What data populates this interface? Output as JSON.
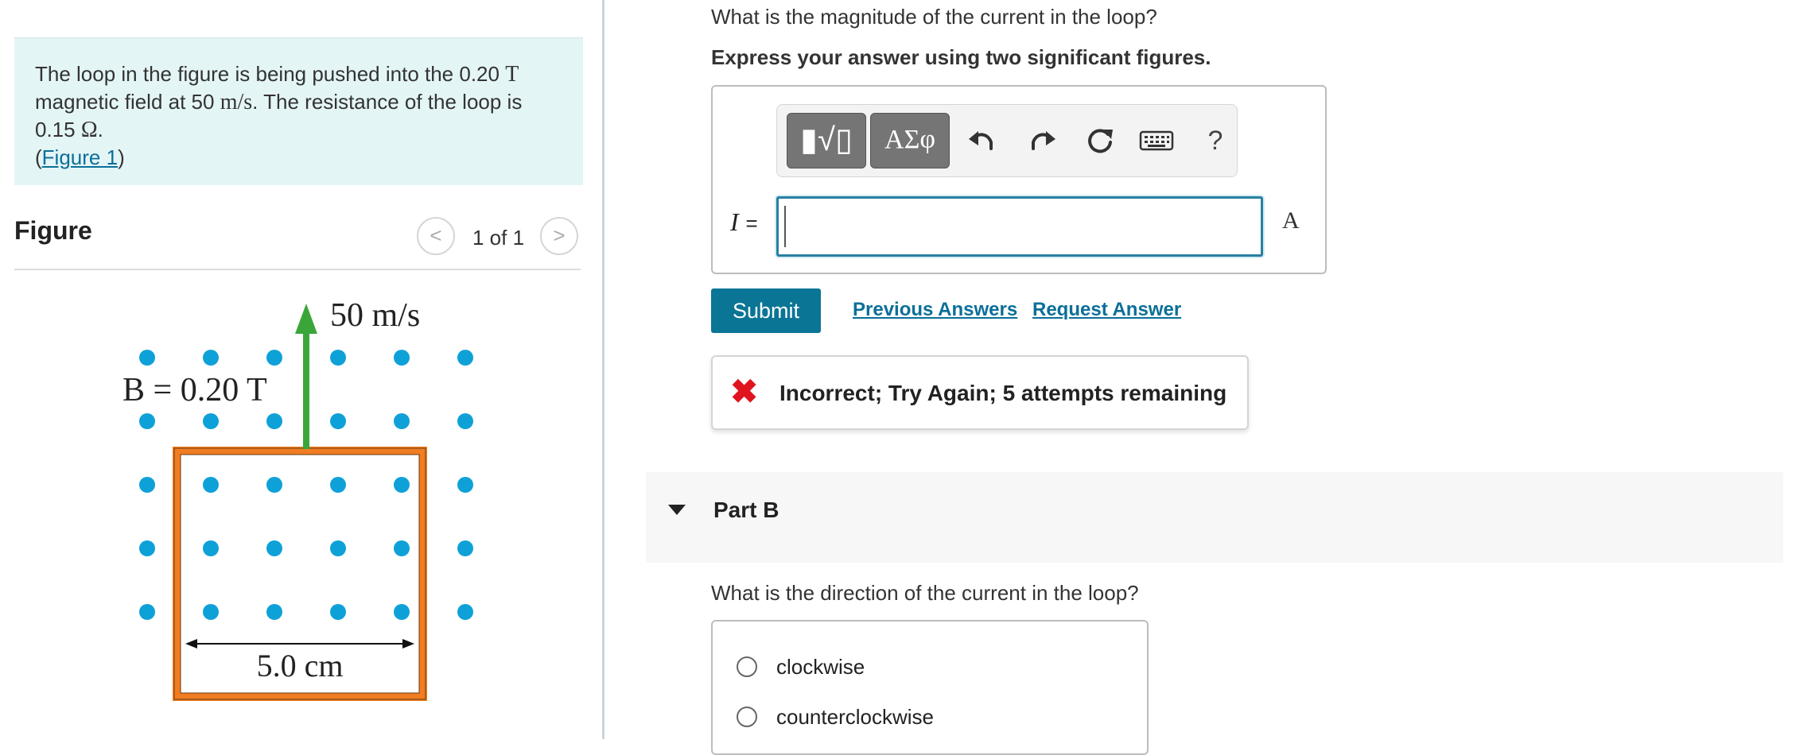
{
  "problem": {
    "text_1": "The loop in the figure is being pushed into the 0.20 ",
    "unit_T": "T",
    "text_2": "magnetic field at 50 ",
    "unit_ms": "m/s",
    "text_3": ". The resistance of the loop is",
    "text_4": "0.15 ",
    "unit_ohm": "Ω",
    "text_5": ".",
    "figure_link_open": "(",
    "figure_link": "Figure 1",
    "figure_link_close": ")"
  },
  "figure_panel": {
    "heading": "Figure",
    "prev_icon": "chevron-left-icon",
    "next_icon": "chevron-right-icon",
    "prev_glyph": "<",
    "next_glyph": ">",
    "count": "1 of 1"
  },
  "figure": {
    "velocity_label": "50 m/s",
    "field_label": "B = 0.20 T",
    "width_label": "5.0 cm",
    "dot_color": "#0ea1d8",
    "loop_color": "#f07d21",
    "arrow_color": "#3aa63a"
  },
  "part_a": {
    "question": "What is the magnitude of the current in the loop?",
    "instruction": "Express your answer using two significant figures.",
    "toolbar": {
      "templates_icon": "templates-icon",
      "templates_glyph": "▮√▯",
      "symbols_label": "ΑΣφ",
      "undo_icon": "undo-icon",
      "redo_icon": "redo-icon",
      "reset_icon": "reset-icon",
      "keyboard_icon": "keyboard-icon",
      "help_label": "?"
    },
    "variable_label": "I",
    "equals": "=",
    "input_value": "",
    "unit": "A",
    "submit_label": "Submit",
    "previous_answers_label": "Previous Answers",
    "request_answer_label": "Request Answer",
    "feedback": {
      "icon_glyph": "✖",
      "text": "Incorrect; Try Again; 5 attempts remaining",
      "color": "#e0141e"
    }
  },
  "part_b": {
    "title": "Part B",
    "question": "What is the direction of the current in the loop?",
    "choices": [
      {
        "label": "clockwise"
      },
      {
        "label": "counterclockwise"
      }
    ]
  },
  "colors": {
    "accent": "#0b7595",
    "link": "#0b6f99",
    "problem_bg": "#e4f5f6"
  }
}
